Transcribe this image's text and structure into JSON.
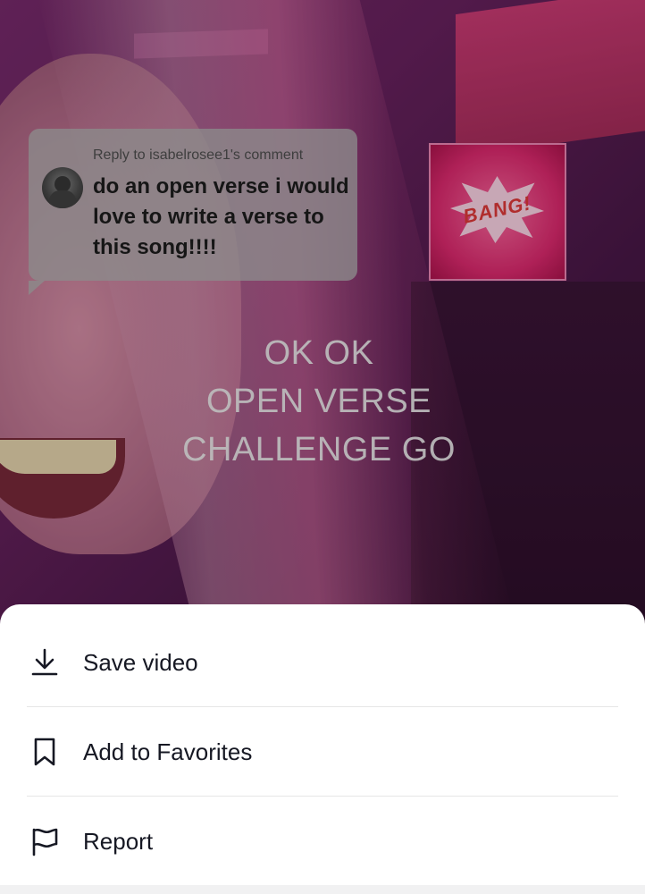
{
  "reply": {
    "header": "Reply to isabelrosee1's comment",
    "comment": "do an open verse i would love to write a verse to this song!!!!"
  },
  "video": {
    "poster_text": "BANG!",
    "caption_lines": [
      "OK OK",
      "OPEN VERSE",
      "CHALLENGE GO"
    ]
  },
  "menu": {
    "items": [
      {
        "label": "Save video",
        "icon": "download-icon"
      },
      {
        "label": "Add to Favorites",
        "icon": "bookmark-icon"
      },
      {
        "label": "Report",
        "icon": "flag-icon"
      }
    ]
  },
  "colors": {
    "sheet_bg": "#ffffff",
    "text_primary": "#161823",
    "divider": "#e6e6e6"
  }
}
